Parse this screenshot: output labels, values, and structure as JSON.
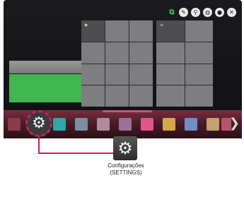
{
  "top_icons": [
    {
      "name": "input-icon",
      "glyph": "⧉"
    },
    {
      "name": "edit-icon",
      "glyph": "✎"
    },
    {
      "name": "search-icon",
      "glyph": "⚲"
    },
    {
      "name": "voice-icon",
      "glyph": "◍"
    },
    {
      "name": "user-icon",
      "glyph": "●"
    },
    {
      "name": "close-icon",
      "glyph": "✕"
    }
  ],
  "panels": {
    "panel_1_mark": "▶",
    "panel_2_mark": "≡"
  },
  "launcher": {
    "settings_glyph": "⚙",
    "chevron": "❯",
    "apps": [
      {
        "color": "#8d3a4c"
      },
      {
        "color": "#2fa7a6"
      },
      {
        "color": "#7a8ea5"
      },
      {
        "color": "#b08a9c"
      },
      {
        "color": "#9b6f96"
      },
      {
        "color": "#e0568c"
      },
      {
        "color": "#d7a84a"
      },
      {
        "color": "#6f8fc9"
      },
      {
        "color": "#c2a071"
      },
      {
        "color": "#b3566c"
      }
    ]
  },
  "callout": {
    "glyph": "⚙",
    "label_line1": "Configurações",
    "label_line2": "(SETTINGS)"
  },
  "colors": {
    "accent": "#d11f52",
    "green_tile": "#3fb650"
  }
}
